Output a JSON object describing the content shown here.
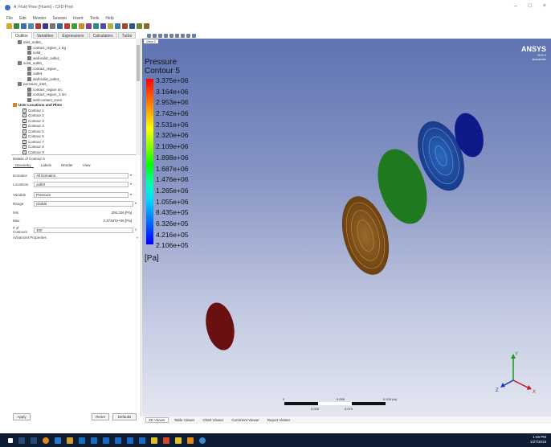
{
  "window": {
    "title": "A: Fluid Flow (Fluent) - CFD-Post",
    "controls": [
      "–",
      "□",
      "×"
    ]
  },
  "menubar": [
    "File",
    "Edit",
    "Monitor",
    "Session",
    "Insert",
    "Tools",
    "Help"
  ],
  "panel_tabs": [
    "Outline",
    "Variables",
    "Expressions",
    "Calculators",
    "Turbo"
  ],
  "tree": [
    {
      "label": "inlet_outlet_",
      "indent": 1,
      "kind": "folder"
    },
    {
      "label": "contact_region_1 trg",
      "indent": 3,
      "kind": "item"
    },
    {
      "label": "solid_",
      "indent": 3,
      "kind": "item"
    },
    {
      "label": "wall-solid_outlet_",
      "indent": 3,
      "kind": "item"
    },
    {
      "label": "solid_outlet_",
      "indent": 1,
      "kind": "folder"
    },
    {
      "label": "contact_region_",
      "indent": 3,
      "kind": "item"
    },
    {
      "label": "outlet",
      "indent": 3,
      "kind": "item"
    },
    {
      "label": "wall-solid_outlet_",
      "indent": 3,
      "kind": "item"
    },
    {
      "label": "pressure_inlet_",
      "indent": 1,
      "kind": "folder"
    },
    {
      "label": "contact_region src",
      "indent": 3,
      "kind": "item"
    },
    {
      "label": "contact_region_1 src",
      "indent": 3,
      "kind": "item"
    },
    {
      "label": "wall-contact_zone",
      "indent": 3,
      "kind": "item"
    },
    {
      "label": "User Locations and Plots",
      "indent": 0,
      "kind": "header"
    },
    {
      "label": "Contour 1",
      "indent": 2,
      "kind": "check"
    },
    {
      "label": "Contour 2",
      "indent": 2,
      "kind": "check"
    },
    {
      "label": "Contour 3",
      "indent": 2,
      "kind": "check"
    },
    {
      "label": "Contour 4",
      "indent": 2,
      "kind": "check"
    },
    {
      "label": "Contour 5",
      "indent": 2,
      "kind": "check"
    },
    {
      "label": "Contour 6",
      "indent": 2,
      "kind": "check"
    },
    {
      "label": "Contour 7",
      "indent": 2,
      "kind": "check"
    },
    {
      "label": "Contour 8",
      "indent": 2,
      "kind": "check"
    },
    {
      "label": "Contour 9",
      "indent": 2,
      "kind": "check"
    }
  ],
  "details": {
    "title": "Details of Contour 5",
    "tabs": [
      "Geometry",
      "Labels",
      "Render",
      "View"
    ],
    "domains_label": "Domains",
    "domains_value": "All Domains",
    "locations_label": "Locations",
    "locations_value": "outlet",
    "variable_label": "Variable",
    "variable_value": "Pressure",
    "range_label": "Range",
    "range_value": "Global",
    "min_label": "Min",
    "min_value": "306.326 [Pa]",
    "max_label": "Max",
    "max_value": "3.37497e+06 [Pa]",
    "contours_label": "# of Contours",
    "contours_value": "100",
    "advanced_label": "Advanced Properties"
  },
  "buttons": {
    "apply": "Apply",
    "reset": "Reset",
    "defaults": "Defaults"
  },
  "viewport": {
    "view_tab": "View 1",
    "legend_title_1": "Pressure",
    "legend_title_2": "Contour 5",
    "legend_values": [
      "3.375e+06",
      "3.164e+06",
      "2.953e+06",
      "2.742e+06",
      "2.531e+06",
      "2.320e+06",
      "2.109e+06",
      "1.898e+06",
      "1.687e+06",
      "1.476e+06",
      "1.265e+06",
      "1.055e+06",
      "8.435e+05",
      "6.326e+05",
      "4.216e+05",
      "2.106e+05"
    ],
    "unit": "[Pa]",
    "brand": "ANSYS",
    "brand_version": "R19.2",
    "brand_edition": "Academic",
    "scale_labels": [
      "0",
      "0.050",
      "0.100 (m)",
      "0.025",
      "0.075"
    ],
    "axes": {
      "x": "X",
      "y": "Y",
      "z": "Z"
    }
  },
  "bottom_tabs": [
    "3D Viewer",
    "Table Viewer",
    "Chart Viewer",
    "Comment Viewer",
    "Report Viewer"
  ],
  "taskbar": {
    "time": "1:46 PM",
    "date": "1/27/2019"
  },
  "colors": {
    "ellipse_1": "#6b1010",
    "ellipse_2": "#8a5a20",
    "ellipse_3": "#1f7a1f",
    "ellipse_4": "#1f4fa8",
    "ellipse_5": "#0f1a8a"
  }
}
